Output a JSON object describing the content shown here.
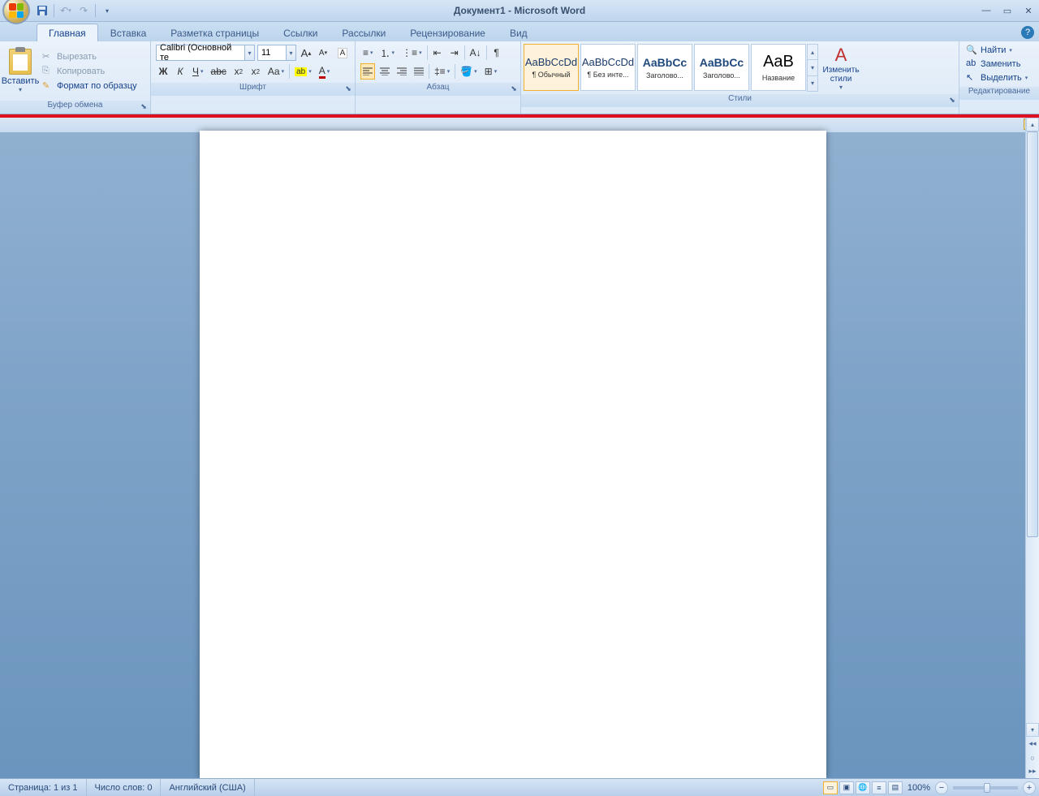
{
  "title": "Документ1 - Microsoft Word",
  "tabs": [
    "Главная",
    "Вставка",
    "Разметка страницы",
    "Ссылки",
    "Рассылки",
    "Рецензирование",
    "Вид"
  ],
  "clipboard": {
    "paste": "Вставить",
    "cut": "Вырезать",
    "copy": "Копировать",
    "format_painter": "Формат по образцу",
    "label": "Буфер обмена"
  },
  "font": {
    "name": "Calibri (Основной те",
    "size": "11",
    "label": "Шрифт"
  },
  "paragraph": {
    "label": "Абзац"
  },
  "styles": {
    "label": "Стили",
    "change": "Изменить стили",
    "items": [
      {
        "preview": "AaBbCcDd",
        "name": "¶ Обычный",
        "cls": ""
      },
      {
        "preview": "AaBbCcDd",
        "name": "¶ Без инте...",
        "cls": ""
      },
      {
        "preview": "AaBbCc",
        "name": "Заголово...",
        "cls": "heading"
      },
      {
        "preview": "AaBbCc",
        "name": "Заголово...",
        "cls": "heading"
      },
      {
        "preview": "AaB",
        "name": "Название",
        "cls": "title"
      }
    ]
  },
  "editing": {
    "label": "Редактирование",
    "find": "Найти",
    "replace": "Заменить",
    "select": "Выделить"
  },
  "status": {
    "page": "Страница: 1 из 1",
    "words": "Число слов: 0",
    "lang": "Английский (США)",
    "zoom": "100%"
  }
}
